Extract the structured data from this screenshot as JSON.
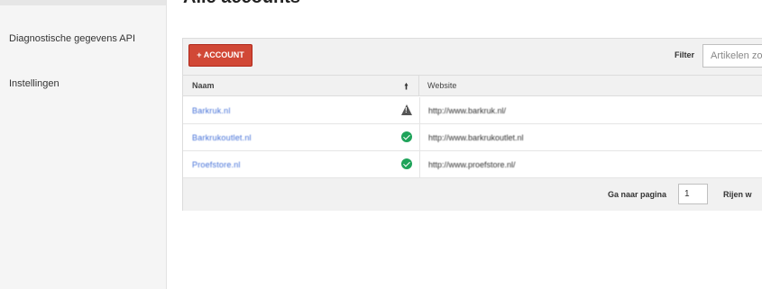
{
  "sidebar": {
    "items": [
      {
        "label": "Diagnostische gegevens API"
      },
      {
        "label": "Instellingen"
      }
    ]
  },
  "page": {
    "title": "Alle accounts"
  },
  "toolbar": {
    "add_label": "+ ACCOUNT",
    "filter_label": "Filter",
    "filter_placeholder": "Artikelen zo"
  },
  "table": {
    "columns": [
      "Naam",
      "Website"
    ],
    "rows": [
      {
        "name": "Barkruk.nl",
        "website": "http://www.barkruk.nl/",
        "status": "warning"
      },
      {
        "name": "Barkrukoutlet.nl",
        "website": "http://www.barkrukoutlet.nl",
        "status": "ok"
      },
      {
        "name": "Proefstore.nl",
        "website": "http://www.proefstore.nl/",
        "status": "ok"
      }
    ]
  },
  "footer": {
    "goto_label": "Ga naar pagina",
    "page_value": "1",
    "rows_label": "Rijen w"
  },
  "colors": {
    "accent": "#d14836",
    "link": "#4470d8",
    "ok": "#1fa35a",
    "warning": "#555555"
  }
}
